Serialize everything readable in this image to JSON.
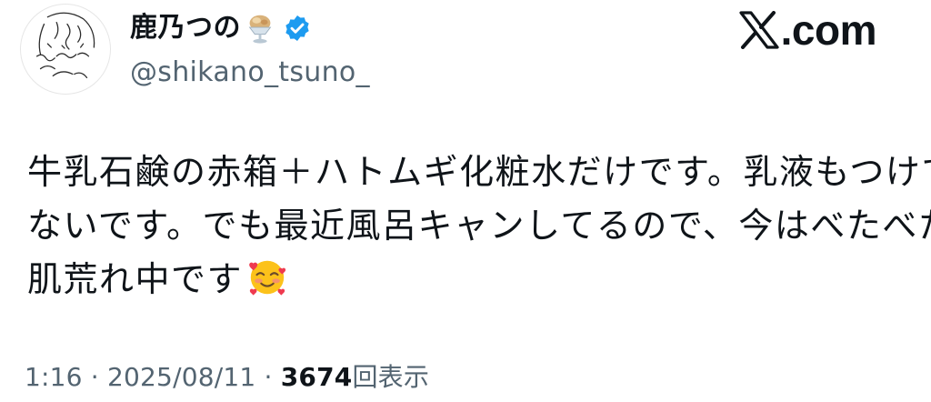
{
  "author": {
    "display_name": "鹿乃つの",
    "handle": "@shikano_tsuno_",
    "avatar_icon": "line-drawing-avatar-icon",
    "name_emoji": "parfait-icon",
    "verified_icon": "verified-badge-icon",
    "verified_color": "#1d9bf0"
  },
  "brand": {
    "label": ".com",
    "logo_icon": "x-logo-icon"
  },
  "tweet": {
    "lines": [
      "牛乳石鹸の赤箱＋ハトムギ化粧水だけです。乳液もつけて",
      "ないです。でも最近風呂キャンしてるので、今はべたべた",
      "肌荒れ中です"
    ],
    "trailing_emoji": "smiling-face-with-hearts-icon"
  },
  "meta": {
    "time": "1:16",
    "separator": "·",
    "date": "2025/08/11",
    "views_count": "3674",
    "views_label": "回表示"
  },
  "colors": {
    "text": "#0f1419",
    "secondary": "#536471",
    "background": "#ffffff"
  }
}
